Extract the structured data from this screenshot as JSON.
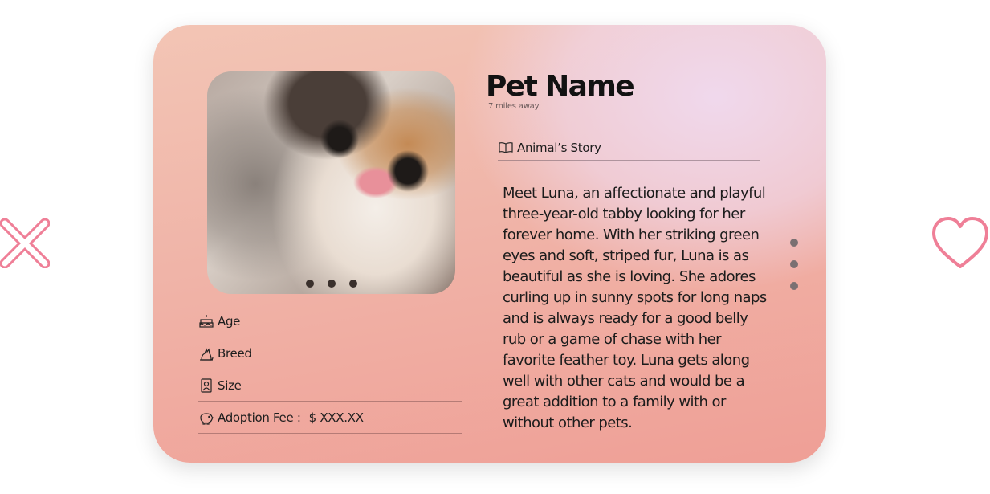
{
  "pet": {
    "name": "Pet Name",
    "distance": "7 miles away"
  },
  "photo": {
    "dots": 3
  },
  "details": {
    "age_label": "Age",
    "breed_label": "Breed",
    "size_label": "Size",
    "fee_label": "Adoption Fee :",
    "fee_value": "$ XXX.XX"
  },
  "story": {
    "header": "Animal’s Story",
    "text": "Meet Luna, an affectionate and playful three-year-old tabby looking for her forever home. With her striking green eyes and soft, striped fur, Luna is as beautiful as she is loving. She adores curling up in sunny spots for long naps and is always ready for a good belly rub or a game of chase with her favorite feather toy. Luna gets along well with other cats and would be a great addition to a family with or without other pets."
  },
  "colors": {
    "action_pink": "#ef7f97",
    "card_peach": "#f0b4a8",
    "card_lavender": "#f0daf0"
  },
  "icons": {
    "reject": "close-x-icon",
    "like": "heart-icon",
    "age": "cake-icon",
    "breed": "cat-icon",
    "size": "scale-icon",
    "fee": "piggy-bank-icon",
    "story": "open-book-icon"
  }
}
